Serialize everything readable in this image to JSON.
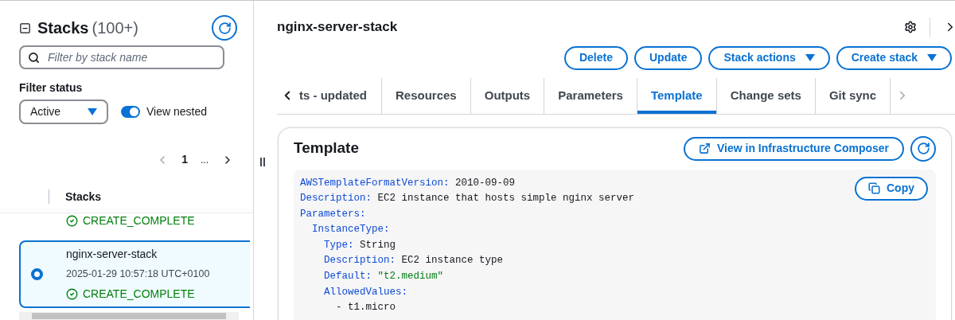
{
  "sidebar": {
    "title": "Stacks",
    "count": "(100+)",
    "search": {
      "placeholder": "Filter by stack name"
    },
    "filter_label": "Filter status",
    "filter_select": {
      "value": "Active"
    },
    "view_nested": {
      "label": "View nested",
      "on": true
    },
    "pagination": {
      "page": "1",
      "more": "..."
    },
    "table": {
      "column": "Stacks",
      "rows": [
        {
          "selected": false,
          "status": {
            "text": "CREATE_COMPLETE",
            "kind": "success"
          }
        },
        {
          "selected": true,
          "name": "nginx-server-stack",
          "date": "2025-01-29 10:57:18 UTC+0100",
          "status": {
            "text": "CREATE_COMPLETE",
            "kind": "success"
          }
        }
      ]
    }
  },
  "main": {
    "title": "nginx-server-stack",
    "actions": [
      {
        "label": "Delete",
        "dropdown": false
      },
      {
        "label": "Update",
        "dropdown": false
      },
      {
        "label": "Stack actions",
        "dropdown": true
      },
      {
        "label": "Create stack",
        "dropdown": true
      }
    ],
    "tabs": [
      {
        "label": "ts - updated",
        "selected": false
      },
      {
        "label": "Resources",
        "selected": false
      },
      {
        "label": "Outputs",
        "selected": false
      },
      {
        "label": "Parameters",
        "selected": false
      },
      {
        "label": "Template",
        "selected": true
      },
      {
        "label": "Change sets",
        "selected": false
      },
      {
        "label": "Git sync",
        "selected": false
      }
    ],
    "template": {
      "title": "Template",
      "composer_button": "View in Infrastructure Composer",
      "copy_button": "Copy",
      "lines": [
        {
          "kind": "pair",
          "key": "AWSTemplateFormatVersion:",
          "value": {
            "text": "2010-09-09",
            "kind": "plain"
          }
        },
        {
          "kind": "pair",
          "key": "Description:",
          "value": {
            "text": "EC2 instance that hosts simple nginx server",
            "kind": "plain"
          }
        },
        {
          "kind": "pair",
          "key": "Parameters:",
          "children": [
            {
              "kind": "pair",
              "key": "InstanceType:",
              "children": [
                {
                  "kind": "pair",
                  "key": "Type:",
                  "value": {
                    "text": "String",
                    "kind": "plain"
                  }
                },
                {
                  "kind": "pair",
                  "key": "Description:",
                  "value": {
                    "text": "EC2 instance type",
                    "kind": "plain"
                  }
                },
                {
                  "kind": "pair",
                  "key": "Default:",
                  "value": {
                    "text": "\"t2.medium\"",
                    "kind": "string"
                  }
                },
                {
                  "kind": "pair",
                  "key": "AllowedValues:",
                  "children": [
                    {
                      "kind": "item",
                      "text": "- t1.micro"
                    }
                  ]
                }
              ]
            }
          ]
        }
      ]
    }
  }
}
